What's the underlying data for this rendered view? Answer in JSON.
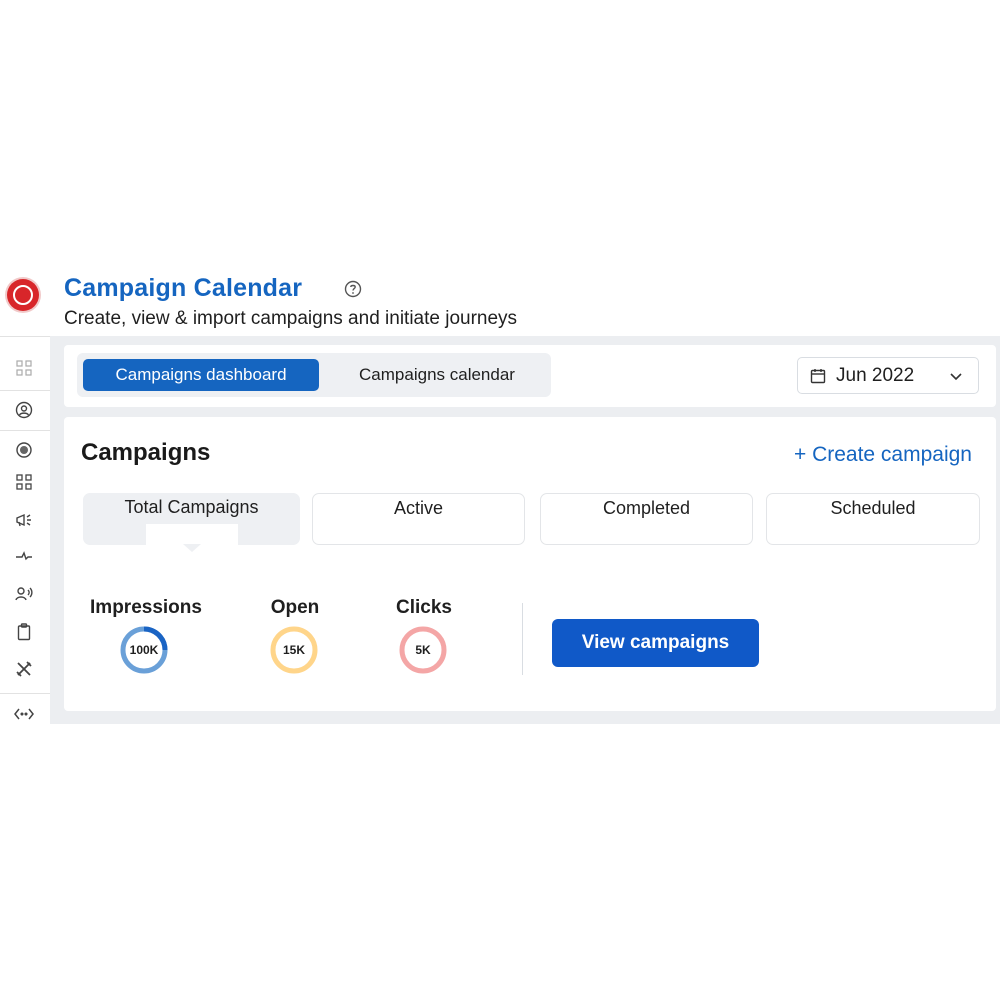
{
  "header": {
    "title": "Campaign Calendar",
    "subtitle": "Create, view & import campaigns and initiate journeys"
  },
  "sidebar": {
    "icons": [
      "dashboard-icon",
      "user-circle-icon",
      "globe-icon",
      "apps-grid-icon",
      "megaphone-icon",
      "flow-icon",
      "audience-icon",
      "clipboard-icon",
      "tools-icon",
      "code-icon"
    ]
  },
  "tabs": {
    "active": "Campaigns dashboard",
    "inactive": "Campaigns calendar"
  },
  "date_picker": {
    "value": "Jun 2022"
  },
  "campaigns": {
    "title": "Campaigns",
    "create_label": "+ Create campaign",
    "stat_tabs": [
      "Total Campaigns",
      "Active",
      "Completed",
      "Scheduled"
    ],
    "selected_stat": "Total Campaigns"
  },
  "metrics": [
    {
      "label": "Impressions",
      "value": "100K",
      "color": "#6aa0d8",
      "accent": "#1a64c4",
      "fill": 0.25
    },
    {
      "label": "Open",
      "value": "15K",
      "color": "#ffd58a",
      "accent": "#ffd58a",
      "fill": 0
    },
    {
      "label": "Clicks",
      "value": "5K",
      "color": "#f4a6a6",
      "accent": "#f4a6a6",
      "fill": 0
    }
  ],
  "view_button": "View campaigns",
  "colors": {
    "primary": "#1565c0",
    "button": "#1059c8",
    "brand_red": "#d8262a"
  }
}
